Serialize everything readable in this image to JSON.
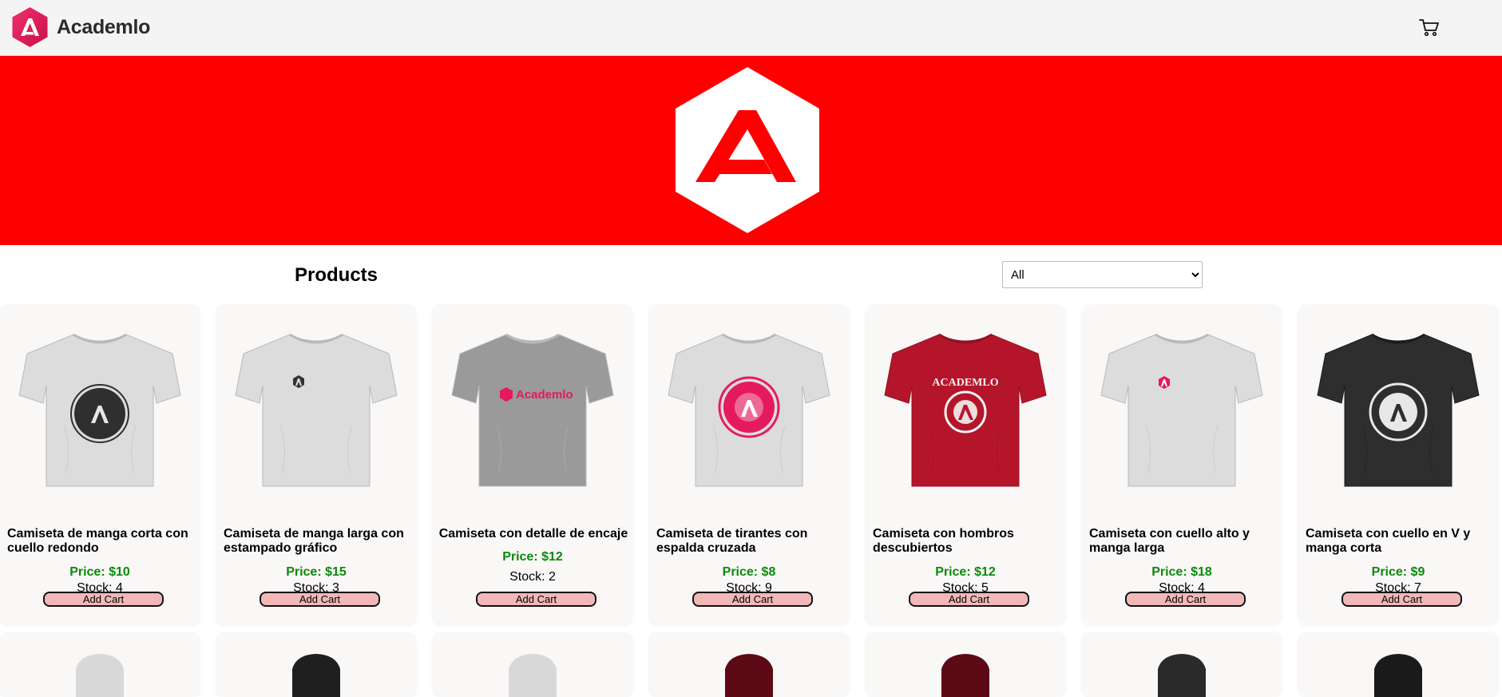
{
  "app": {
    "name": "Academlo"
  },
  "header": {
    "cart_icon": "cart-icon"
  },
  "main": {
    "title": "Products",
    "filter": {
      "selected": "All",
      "options": [
        "All"
      ]
    }
  },
  "colors": {
    "hero_bg": "#ff0000",
    "price": "#0a8a0a",
    "button_bg": "#f2b8b8",
    "brand_pink": "#e5195f"
  },
  "products": [
    {
      "title": "Camiseta de manga corta con cuello redondo",
      "price": "Price: $10",
      "stock": "Stock: 4",
      "button": "Add Cart",
      "shirt_color": "#dcdcdc",
      "print": "dark-circle-badge"
    },
    {
      "title": "Camiseta de manga larga con estampado gráfico",
      "price": "Price: $15",
      "stock": "Stock: 3",
      "button": "Add Cart",
      "shirt_color": "#dcdcdc",
      "print": "small-dark-logo"
    },
    {
      "title": "Camiseta con detalle de encaje",
      "price": "Price: $12",
      "stock": "Stock: 2",
      "button": "Add Cart",
      "shirt_color": "#9a9a9a",
      "print": "pink-wordmark"
    },
    {
      "title": "Camiseta de tirantes con espalda cruzada",
      "price": "Price: $8",
      "stock": "Stock: 9",
      "button": "Add Cart",
      "shirt_color": "#dcdcdc",
      "print": "pink-circle-badge"
    },
    {
      "title": "Camiseta con hombros descubiertos",
      "price": "Price: $12",
      "stock": "Stock: 5",
      "button": "Add Cart",
      "shirt_color": "#b5152b",
      "print": "white-college-badge"
    },
    {
      "title": "Camiseta con cuello alto y manga larga",
      "price": "Price: $18",
      "stock": "Stock: 4",
      "button": "Add Cart",
      "shirt_color": "#dcdcdc",
      "print": "small-pink-logo"
    },
    {
      "title": "Camiseta con cuello en V y manga corta",
      "price": "Price: $9",
      "stock": "Stock: 7",
      "button": "Add Cart",
      "shirt_color": "#2e2e2e",
      "print": "light-circle-badge"
    }
  ],
  "second_row_hoodie_colors": [
    "#d8d8d8",
    "#1f1f1f",
    "#d8d8d8",
    "#5c0a16",
    "#5c0a16",
    "#2a2a2a",
    "#1a1a1a"
  ]
}
